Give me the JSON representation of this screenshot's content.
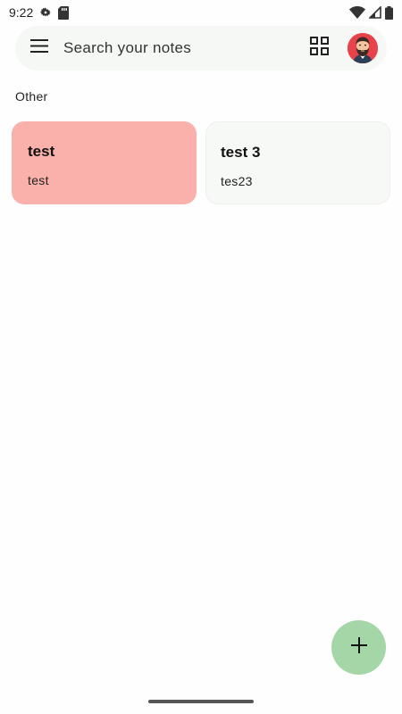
{
  "status_bar": {
    "time": "9:22",
    "icons": [
      "settings-icon",
      "sd-card-icon",
      "wifi-icon",
      "signal-icon",
      "battery-icon"
    ]
  },
  "search": {
    "placeholder": "Search your notes",
    "icons": [
      "menu-icon",
      "grid-view-icon",
      "avatar"
    ]
  },
  "section": {
    "label": "Other"
  },
  "notes": [
    {
      "title": "test",
      "body": "test",
      "color": "#fbb1ab"
    },
    {
      "title": "test 3",
      "body": "tes23",
      "color": "#f7f9f6"
    }
  ],
  "fab": {
    "icon": "plus-icon",
    "color": "#a5d6a7"
  }
}
